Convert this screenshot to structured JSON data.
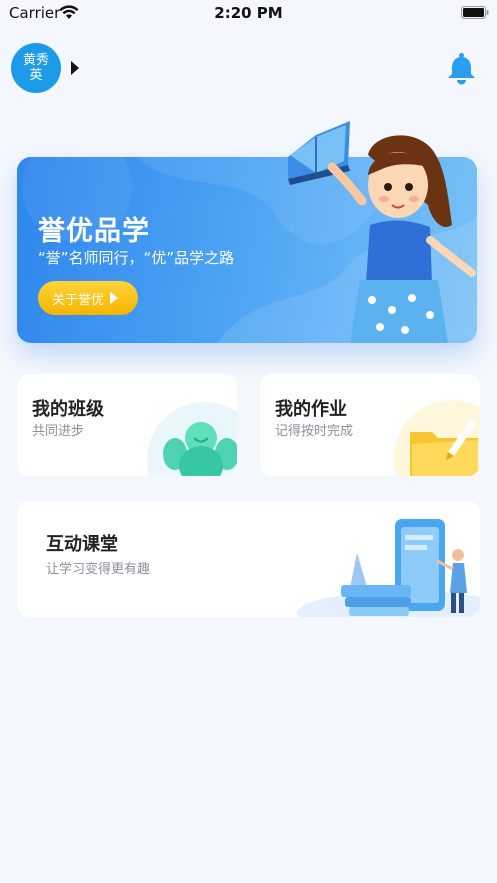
{
  "status_bar": {
    "carrier": "Carrier",
    "time": "2:20 PM"
  },
  "header": {
    "avatar_name": "黄秀英",
    "avatar_arrow_icon": "caret-right-icon",
    "notification_icon": "bell-icon"
  },
  "banner": {
    "title": "誉优品学",
    "subtitle": "“誉”名师同行，“优”品学之路",
    "button_label": "关于誉优"
  },
  "cards": {
    "class": {
      "title": "我的班级",
      "subtitle": "共同进步"
    },
    "homework": {
      "title": "我的作业",
      "subtitle": "记得按时完成"
    },
    "classroom": {
      "title": "互动课堂",
      "subtitle": "让学习变得更有趣"
    }
  },
  "colors": {
    "primary": "#1e9be8",
    "banner_start": "#2f86ec",
    "button_yellow": "#f6b400",
    "background": "#f4f7fd"
  }
}
